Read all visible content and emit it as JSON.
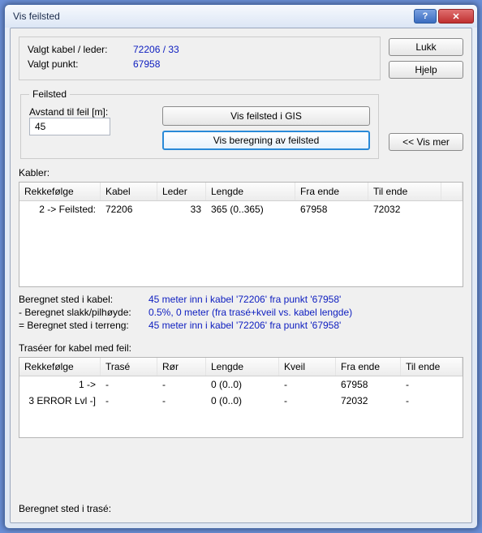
{
  "window": {
    "title": "Vis feilsted"
  },
  "titlebar": {
    "help_glyph": "?",
    "close_glyph": "✕"
  },
  "buttons": {
    "lukk": "Lukk",
    "hjelp": "Hjelp",
    "vis_gis": "Vis feilsted i GIS",
    "vis_beregning": "Vis beregning av feilsted",
    "vis_mer": "<< Vis mer"
  },
  "summary": {
    "kabel_label": "Valgt kabel / leder:",
    "kabel_value": "72206 / 33",
    "punkt_label": "Valgt punkt:",
    "punkt_value": "67958"
  },
  "feilsted": {
    "legend": "Feilsted",
    "avstand_label": "Avstand til feil [m]:",
    "avstand_value": "45"
  },
  "kabler": {
    "label": "Kabler:",
    "headers": [
      "Rekkefølge",
      "Kabel",
      "Leder",
      "Lengde",
      "Fra ende",
      "Til ende",
      ""
    ],
    "rows": [
      [
        "2 -> Feilsted:",
        "72206",
        "33",
        "365 (0..365)",
        "67958",
        "72032",
        ""
      ]
    ]
  },
  "beregnet": {
    "r1k": "Beregnet sted i kabel:",
    "r1v": "45 meter inn i kabel '72206' fra punkt '67958'",
    "r2k": "- Beregnet slakk/pilhøyde:",
    "r2v": "0.5%, 0 meter (fra trasé+kveil vs. kabel lengde)",
    "r3k": "= Beregnet sted i terreng:",
    "r3v": "45 meter inn i kabel '72206' fra punkt '67958'"
  },
  "traseer": {
    "label": "Traséer for kabel med feil:",
    "headers": [
      "Rekkefølge",
      "Trasé",
      "Rør",
      "Lengde",
      "Kveil",
      "Fra ende",
      "Til ende"
    ],
    "rows": [
      [
        "1 ->",
        "-",
        "-",
        "0 (0..0)",
        "-",
        "67958",
        "-"
      ],
      [
        "3 ERROR Lvl -]",
        "-",
        "-",
        "0 (0..0)",
        "-",
        "72032",
        "-"
      ]
    ]
  },
  "bottom": {
    "label": "Beregnet sted i trasé:",
    "value": ""
  }
}
